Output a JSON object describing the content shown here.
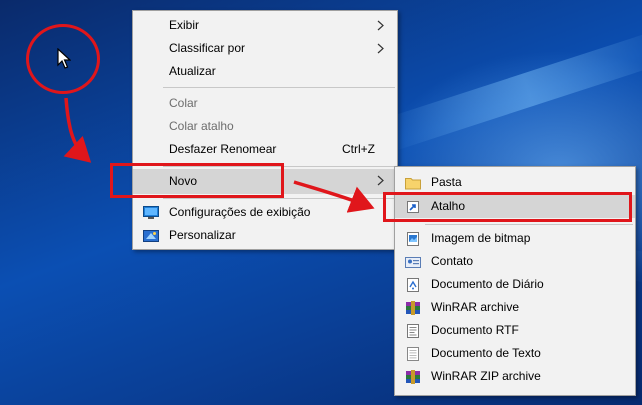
{
  "context_menu": {
    "items": [
      {
        "label": "Exibir",
        "submenu": true
      },
      {
        "label": "Classificar por",
        "submenu": true
      },
      {
        "label": "Atualizar"
      },
      {
        "label": "Colar",
        "disabled": true
      },
      {
        "label": "Colar atalho",
        "disabled": true
      },
      {
        "label": "Desfazer Renomear",
        "shortcut": "Ctrl+Z"
      },
      {
        "label": "Novo",
        "submenu": true,
        "highlighted": true
      },
      {
        "label": "Configurações de exibição",
        "icon": "display-settings-icon"
      },
      {
        "label": "Personalizar",
        "icon": "personalize-icon"
      }
    ]
  },
  "submenu_novo": {
    "items": [
      {
        "label": "Pasta",
        "icon": "folder-icon"
      },
      {
        "label": "Atalho",
        "icon": "shortcut-icon",
        "highlighted": true
      },
      {
        "label": "Imagem de bitmap",
        "icon": "bitmap-image-icon"
      },
      {
        "label": "Contato",
        "icon": "contact-icon"
      },
      {
        "label": "Documento de Diário",
        "icon": "journal-document-icon"
      },
      {
        "label": "WinRAR archive",
        "icon": "winrar-archive-icon"
      },
      {
        "label": "Documento RTF",
        "icon": "rtf-document-icon"
      },
      {
        "label": "Documento de Texto",
        "icon": "text-document-icon"
      },
      {
        "label": "WinRAR ZIP archive",
        "icon": "winrar-zip-icon"
      }
    ]
  },
  "colors": {
    "annotation_red": "#e0161b",
    "menu_bg": "#f2f2f2",
    "highlight_bg": "#d5d5d5",
    "desktop_blue": "#0b4fb3"
  }
}
